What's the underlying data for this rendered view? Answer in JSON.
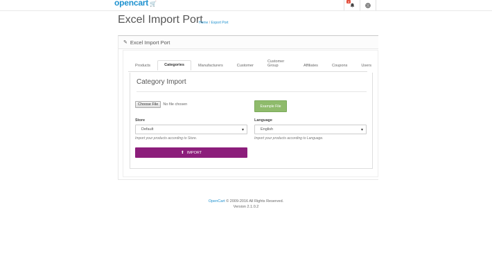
{
  "header": {
    "logo_text": "opencart",
    "notification_count": "4"
  },
  "page": {
    "title": "Excel Import Port",
    "breadcrumb": [
      {
        "label": "Home"
      },
      {
        "label": "Export Port"
      }
    ],
    "breadcrumb_separator": "/"
  },
  "panel": {
    "heading": "Excel Import Port"
  },
  "tabs": [
    {
      "label": "Products",
      "active": false
    },
    {
      "label": "Categories",
      "active": true
    },
    {
      "label": "Manufacturers",
      "active": false
    },
    {
      "label": "Customer",
      "active": false
    },
    {
      "label": "Customer Group",
      "active": false
    },
    {
      "label": "Affiliates",
      "active": false
    },
    {
      "label": "Coupons",
      "active": false
    },
    {
      "label": "Users",
      "active": false
    }
  ],
  "form": {
    "section_title": "Category Import",
    "choose_file_label": "Choose File",
    "no_file_text": "No file chosen",
    "example_file_label": "Example File",
    "store_label": "Store",
    "store_value": "Default",
    "store_help": "Import your products according to Store.",
    "language_label": "Language",
    "language_value": "English",
    "language_help": "Import your products according to Language.",
    "import_label": "IMPORT"
  },
  "footer": {
    "brand": "OpenCart",
    "copyright": "© 2009-2016 All Rights Reserved.",
    "version": "Version 2.1.0.2"
  },
  "colors": {
    "accent": "#1e91cf",
    "import_button": "#8c1e7b",
    "example_button": "#8fbb6c",
    "badge": "#e3503e"
  }
}
